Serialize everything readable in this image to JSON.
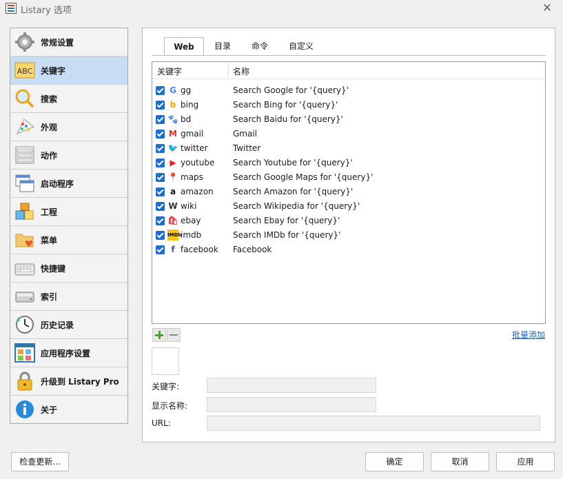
{
  "window": {
    "title": "Listary 选项"
  },
  "sidebar": {
    "items": [
      {
        "label": "常规设置",
        "icon": "gear-icon"
      },
      {
        "label": "关键字",
        "icon": "abc-icon",
        "selected": true,
        "icon_text": "ABC"
      },
      {
        "label": "搜索",
        "icon": "magnifier-icon"
      },
      {
        "label": "外观",
        "icon": "palette-icon"
      },
      {
        "label": "动作",
        "icon": "menu-list-icon"
      },
      {
        "label": "启动程序",
        "icon": "window-stack-icon"
      },
      {
        "label": "工程",
        "icon": "cubes-icon"
      },
      {
        "label": "菜单",
        "icon": "folder-heart-icon"
      },
      {
        "label": "快捷键",
        "icon": "keyboard-icon"
      },
      {
        "label": "索引",
        "icon": "drive-icon"
      },
      {
        "label": "历史记录",
        "icon": "clock-icon"
      },
      {
        "label": "应用程序设置",
        "icon": "app-grid-icon"
      },
      {
        "label": "升级到 Listary Pro",
        "icon": "lock-icon"
      },
      {
        "label": "关于",
        "icon": "info-icon"
      }
    ]
  },
  "tabs": [
    {
      "label": "Web",
      "active": true
    },
    {
      "label": "目录"
    },
    {
      "label": "命令"
    },
    {
      "label": "自定义"
    }
  ],
  "list": {
    "headers": {
      "keyword": "关键字",
      "name": "名称"
    },
    "rows": [
      {
        "keyword": "gg",
        "name": "Search Google for '{query}'",
        "icon": "google-icon",
        "glyph": "G",
        "color": "#4285f4"
      },
      {
        "keyword": "bing",
        "name": "Search Bing for '{query}'",
        "icon": "bing-icon",
        "glyph": "b",
        "color": "#f2a60c"
      },
      {
        "keyword": "bd",
        "name": "Search Baidu for '{query}'",
        "icon": "baidu-icon",
        "glyph": "🐾",
        "color": "#2932e1"
      },
      {
        "keyword": "gmail",
        "name": "Gmail",
        "icon": "gmail-icon",
        "glyph": "M",
        "color": "#d93025"
      },
      {
        "keyword": "twitter",
        "name": "Twitter",
        "icon": "twitter-icon",
        "glyph": "🐦",
        "color": "#1da1f2"
      },
      {
        "keyword": "youtube",
        "name": "Search Youtube for '{query}'",
        "icon": "youtube-icon",
        "glyph": "▶",
        "color": "#e62117"
      },
      {
        "keyword": "maps",
        "name": "Search Google Maps for '{query}'",
        "icon": "maps-icon",
        "glyph": "📍",
        "color": "#34a853"
      },
      {
        "keyword": "amazon",
        "name": "Search Amazon for '{query}'",
        "icon": "amazon-icon",
        "glyph": "a",
        "color": "#111111"
      },
      {
        "keyword": "wiki",
        "name": "Search Wikipedia for '{query}'",
        "icon": "wikipedia-icon",
        "glyph": "W",
        "color": "#333333"
      },
      {
        "keyword": "ebay",
        "name": "Search Ebay for '{query}'",
        "icon": "ebay-icon",
        "glyph": "🛍",
        "color": "#e53238"
      },
      {
        "keyword": "imdb",
        "name": "Search IMDb for '{query}'",
        "icon": "imdb-icon",
        "glyph": "IMDb",
        "color": "#f5c518"
      },
      {
        "keyword": "facebook",
        "name": "Facebook",
        "icon": "facebook-icon",
        "glyph": "f",
        "color": "#3b5998"
      }
    ]
  },
  "actions": {
    "bulk_add": "批量添加"
  },
  "form": {
    "keyword_label": "关键字:",
    "display_name_label": "显示名称:",
    "url_label": "URL:",
    "keyword_value": "",
    "display_name_value": "",
    "url_value": ""
  },
  "footer": {
    "check_updates": "检查更新...",
    "ok": "确定",
    "cancel": "取消",
    "apply": "应用"
  },
  "colors": {
    "selection": "#c7ddf3",
    "checkbox": "#1f6fc8",
    "link": "#1a66c2"
  }
}
